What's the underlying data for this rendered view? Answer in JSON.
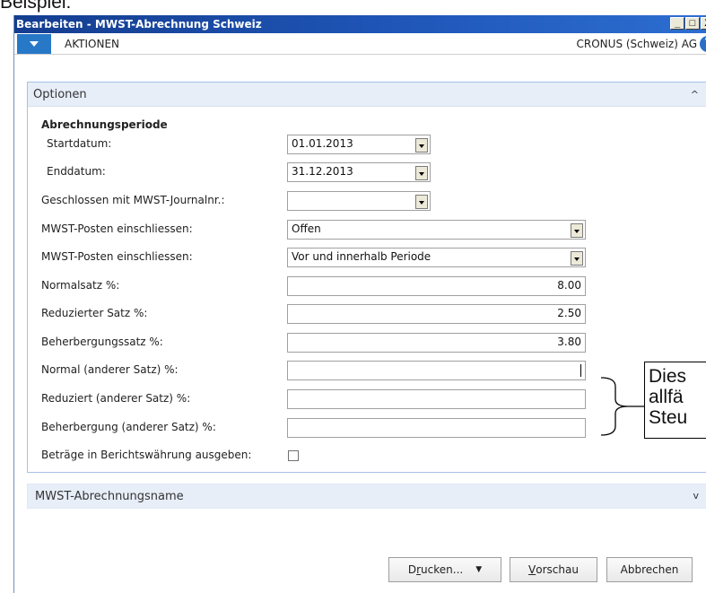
{
  "document_snippet": "Beispiel:",
  "window": {
    "title": "Bearbeiten - MWST-Abrechnung Schweiz",
    "controls": [
      "_",
      "□",
      "X"
    ]
  },
  "toolbar": {
    "actions_label": "AKTIONEN",
    "company": "CRONUS (Schweiz) AG",
    "help_icon": "help-icon"
  },
  "options_tab": {
    "title": "Optionen",
    "chevron": "^",
    "group_label": "Abrechnungsperiode",
    "fields": {
      "start_label": "Startdatum:",
      "start_value": "01.01.2013",
      "end_label": "Enddatum:",
      "end_value": "31.12.2013",
      "closed_label": "Geschlossen mit MWST-Journalnr.:",
      "closed_value": "",
      "include1_label": "MWST-Posten einschliessen:",
      "include1_value": "Offen",
      "include2_label": "MWST-Posten einschliessen:",
      "include2_value": "Vor und innerhalb Periode",
      "normal_label": "Normalsatz %:",
      "normal_value": "8.00",
      "reduced_label": "Reduzierter Satz %:",
      "reduced_value": "2.50",
      "lodging_label": "Beherbergungssatz %:",
      "lodging_value": "3.80",
      "normal_other_label": "Normal (anderer Satz) %:",
      "normal_other_value": "",
      "reduced_other_label": "Reduziert (anderer Satz) %:",
      "reduced_other_value": "",
      "lodging_other_label": "Beherbergung (anderer Satz) %:",
      "lodging_other_value": "",
      "currency_label": "Beträge in Berichtswährung ausgeben:",
      "currency_checked": false
    }
  },
  "name_tab": {
    "title": "MWST-Abrechnungsname",
    "chevron": "v"
  },
  "buttons": {
    "print_prefix": "D",
    "print_underlined": "r",
    "print_rest": "ucken...",
    "print_arrow": "▼",
    "preview_underlined": "V",
    "preview_rest": "orschau",
    "cancel": "Abbrechen"
  },
  "callout": {
    "line1": "Dies",
    "line2": "allfä",
    "line3": "Steu"
  }
}
